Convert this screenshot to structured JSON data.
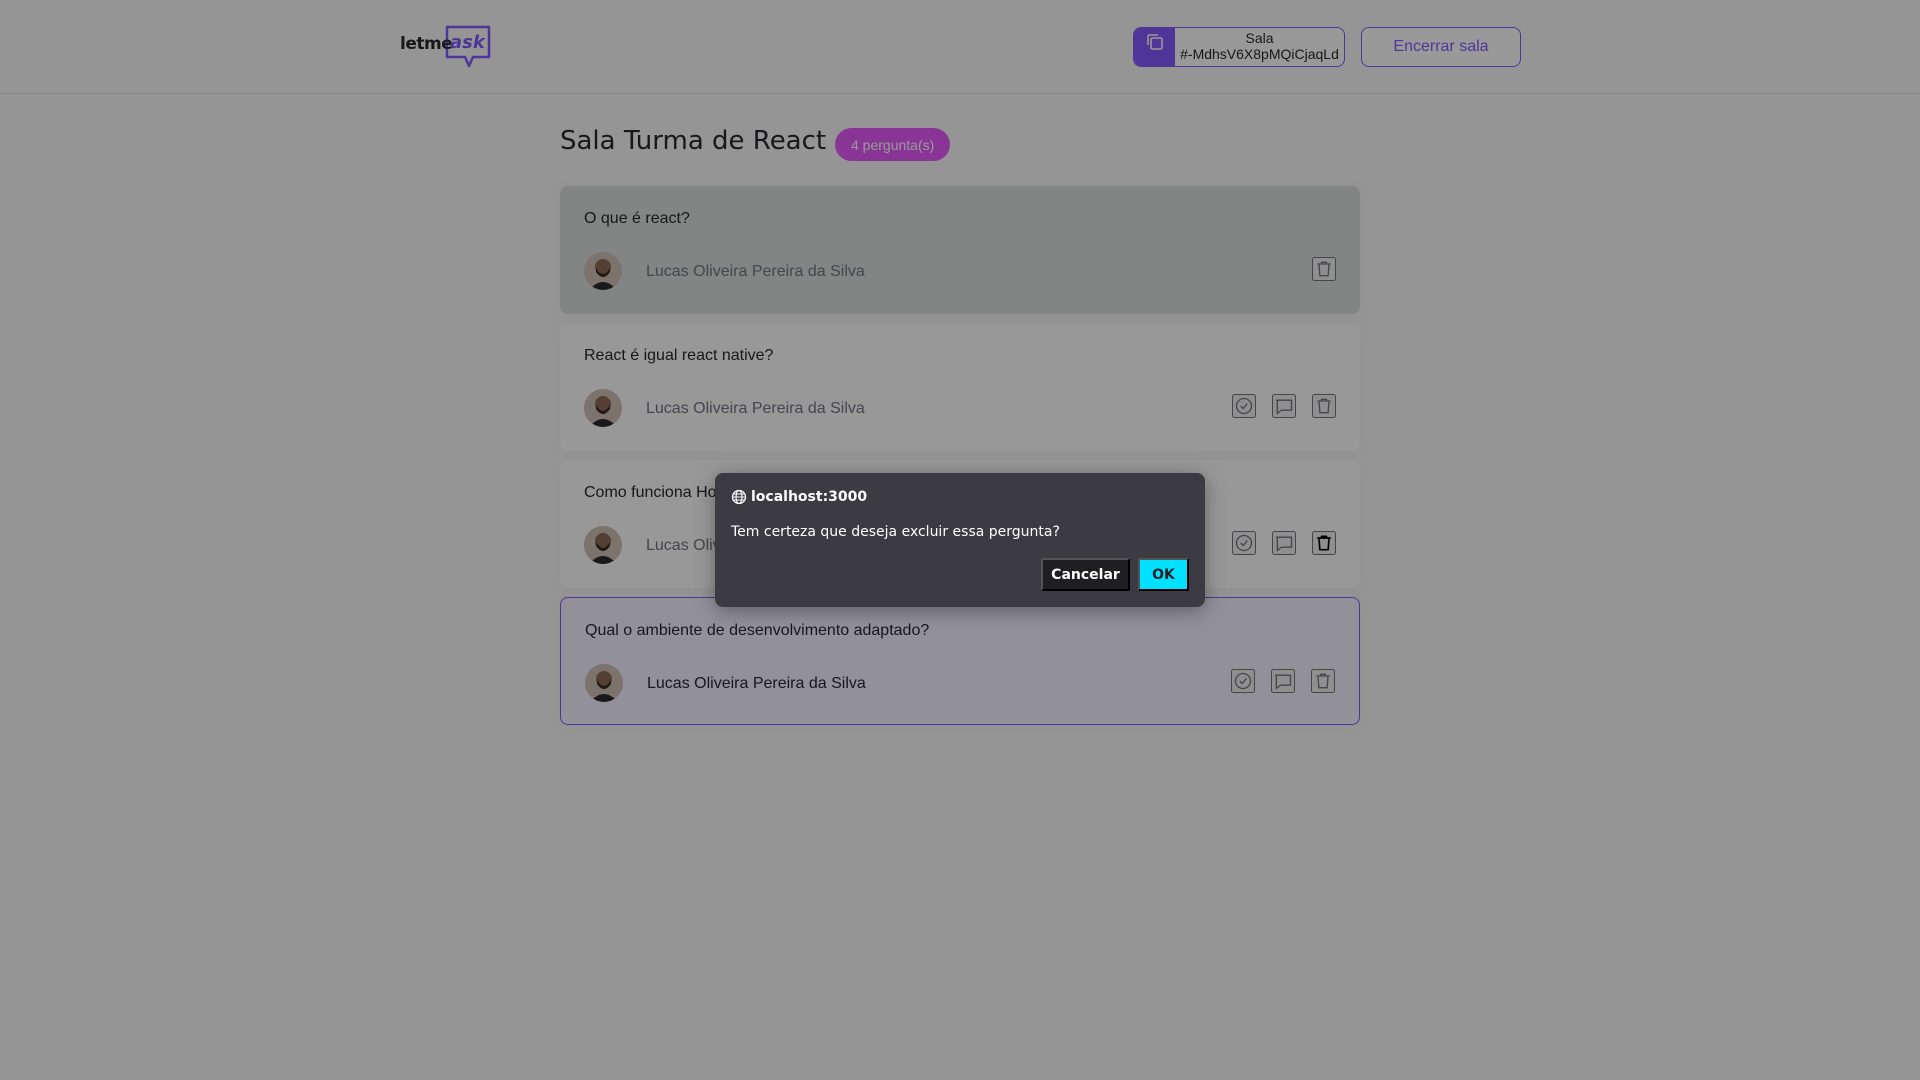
{
  "header": {
    "logo_part1": "letme",
    "logo_part2": "ask",
    "room_code_label": "Sala",
    "room_code": "#-MdhsV6X8pMQiCjaqLd",
    "close_room_label": "Encerrar sala"
  },
  "room": {
    "title": "Sala Turma de React",
    "question_count": "4 pergunta(s)"
  },
  "questions": [
    {
      "text": "O que é react?",
      "author": "Lucas Oliveira Pereira da Silva",
      "state": "answered"
    },
    {
      "text": "React é igual react native?",
      "author": "Lucas Oliveira Pereira da Silva",
      "state": "normal"
    },
    {
      "text": "Como funciona Hooks?",
      "author": "Lucas Oliveira Pereira da Silva",
      "state": "normal"
    },
    {
      "text": "Qual o ambiente de desenvolvimento adaptado?",
      "author": "Lucas Oliveira Pereira da Silva",
      "state": "highlighted"
    }
  ],
  "dialog": {
    "origin": "localhost:3000",
    "message": "Tem certeza que deseja excluir essa pergunta?",
    "cancel_label": "Cancelar",
    "ok_label": "OK"
  },
  "colors": {
    "accent": "#835afd",
    "badge": "#e559f9",
    "ok_button": "#00e1ff"
  }
}
